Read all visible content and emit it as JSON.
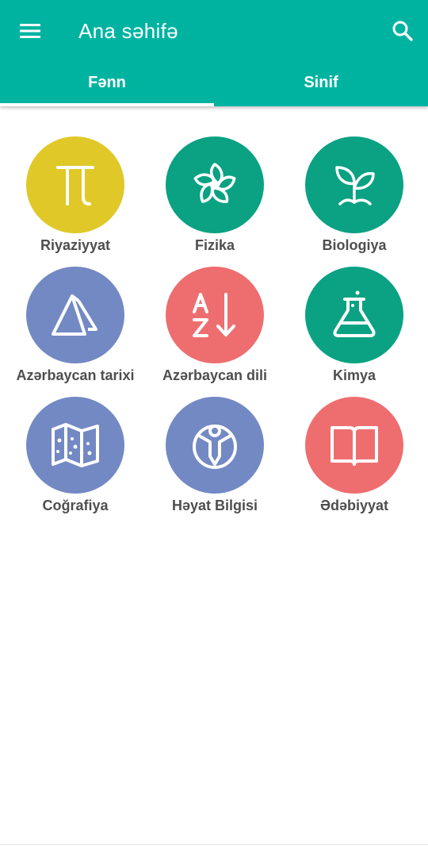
{
  "appbar": {
    "title": "Ana səhifə",
    "menu_icon": "menu-icon",
    "search_icon": "search-icon",
    "color": "#00b3a1"
  },
  "tabs": [
    {
      "label": "Fənn",
      "selected": true
    },
    {
      "label": "Sinif",
      "selected": false
    }
  ],
  "subjects": [
    {
      "label": "Riyaziyyat",
      "icon": "pi-icon",
      "color": "#e0c829"
    },
    {
      "label": "Fizika",
      "icon": "atom-icon",
      "color": "#0aa282"
    },
    {
      "label": "Biologiya",
      "icon": "sprout-icon",
      "color": "#0aa282"
    },
    {
      "label": "Azərbaycan tarixi",
      "icon": "pyramid-icon",
      "color": "#7389c4"
    },
    {
      "label": "Azərbaycan dili",
      "icon": "sort-az-icon",
      "color": "#ee6e70"
    },
    {
      "label": "Kimya",
      "icon": "flask-icon",
      "color": "#0aa282"
    },
    {
      "label": "Coğrafiya",
      "icon": "map-icon",
      "color": "#7389c4"
    },
    {
      "label": "Həyat Bilgisi",
      "icon": "person-icon",
      "color": "#7389c4"
    },
    {
      "label": "Ədəbiyyat",
      "icon": "book-icon",
      "color": "#ee6e70"
    }
  ]
}
